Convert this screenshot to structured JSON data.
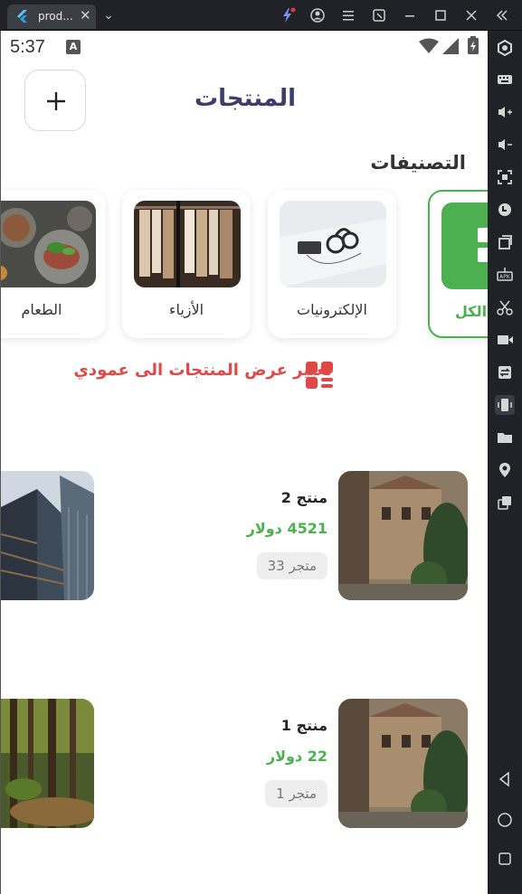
{
  "window": {
    "tab_title": "prod...",
    "tab_close": "✕",
    "chevron": "⌄"
  },
  "status_bar": {
    "time": "5:37",
    "notification_icon": "A"
  },
  "header": {
    "title": "المنتجات",
    "add_button": "+"
  },
  "categories": {
    "title": "التصنيفات",
    "items": [
      {
        "label": "الكل",
        "active": true
      },
      {
        "label": "الإلكترونيات",
        "active": false
      },
      {
        "label": "الأزياء",
        "active": false
      },
      {
        "label": "الطعام",
        "active": false
      }
    ]
  },
  "view_toggle": {
    "label": "تغيير عرض المنتجات الى عمودي"
  },
  "products": [
    {
      "name": "منتج 2",
      "price": "4521 دولار",
      "store": "متجر 33"
    },
    {
      "name": "منتج 1",
      "price": "22 دولار",
      "store": "متجر 1"
    }
  ],
  "colors": {
    "accent_green": "#4caf50",
    "accent_red": "#e04848",
    "title_color": "#3d3d6b"
  }
}
